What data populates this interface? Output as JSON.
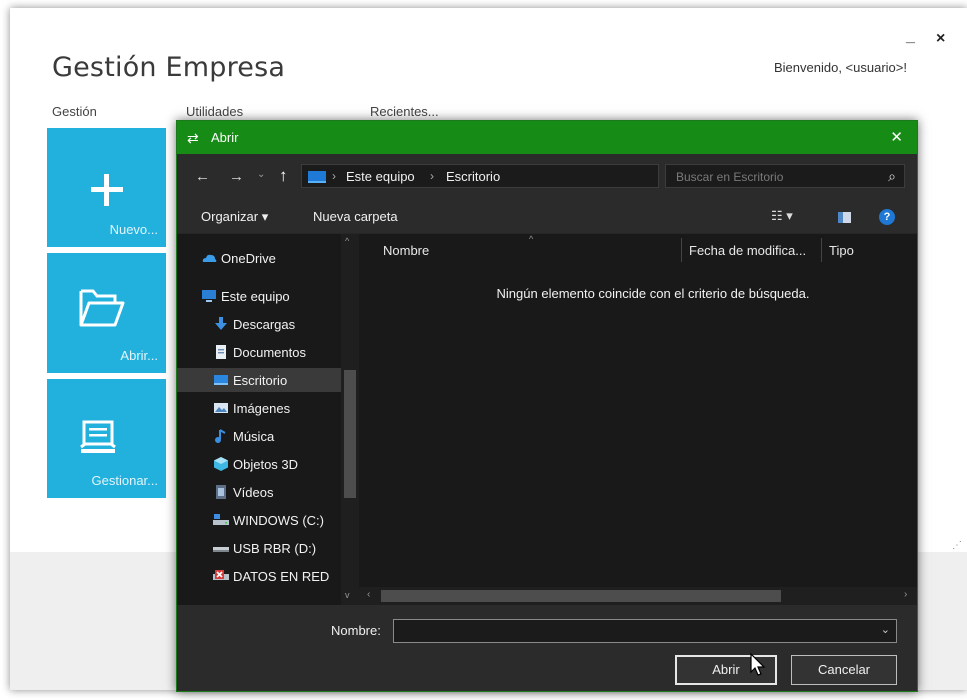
{
  "app": {
    "title": "Gestión Empresa",
    "minimize_glyph": "_",
    "close_glyph": "×",
    "welcome": "Bienvenido, <usuario>!",
    "menu": [
      "Gestión",
      "Utilidades",
      "Recientes..."
    ],
    "tiles": [
      {
        "label": "Nuevo...",
        "icon": "plus-icon"
      },
      {
        "label": "Abrir...",
        "icon": "folder-icon"
      },
      {
        "label": "Gestionar...",
        "icon": "laptop-icon"
      }
    ],
    "accent": "#22b1dd"
  },
  "dialog": {
    "title": "Abrir",
    "accent": "#168b16",
    "address": {
      "segments": [
        "Este equipo",
        "Escritorio"
      ]
    },
    "search_placeholder": "Buscar en Escritorio",
    "toolbar": {
      "organize": "Organizar ▾",
      "new_folder": "Nueva carpeta"
    },
    "nav_items": [
      {
        "label": "OneDrive",
        "icon": "onedrive-icon"
      },
      {
        "label": "Este equipo",
        "icon": "computer-icon"
      },
      {
        "label": "Descargas",
        "icon": "downloads-icon"
      },
      {
        "label": "Documentos",
        "icon": "documents-icon"
      },
      {
        "label": "Escritorio",
        "icon": "desktop-icon",
        "selected": true
      },
      {
        "label": "Imágenes",
        "icon": "pictures-icon"
      },
      {
        "label": "Música",
        "icon": "music-icon"
      },
      {
        "label": "Objetos 3D",
        "icon": "objects-3d-icon"
      },
      {
        "label": "Vídeos",
        "icon": "videos-icon"
      },
      {
        "label": "WINDOWS (C:)",
        "icon": "drive-icon"
      },
      {
        "label": "USB RBR (D:)",
        "icon": "usb-drive-icon"
      },
      {
        "label": "DATOS EN RED",
        "icon": "network-drive-icon"
      }
    ],
    "columns": [
      "Nombre",
      "Fecha de modifica...",
      "Tipo"
    ],
    "empty_message": "Ningún elemento coincide con el criterio de búsqueda.",
    "name_label": "Nombre:",
    "name_value": "",
    "buttons": {
      "open": "Abrir",
      "cancel": "Cancelar"
    }
  }
}
